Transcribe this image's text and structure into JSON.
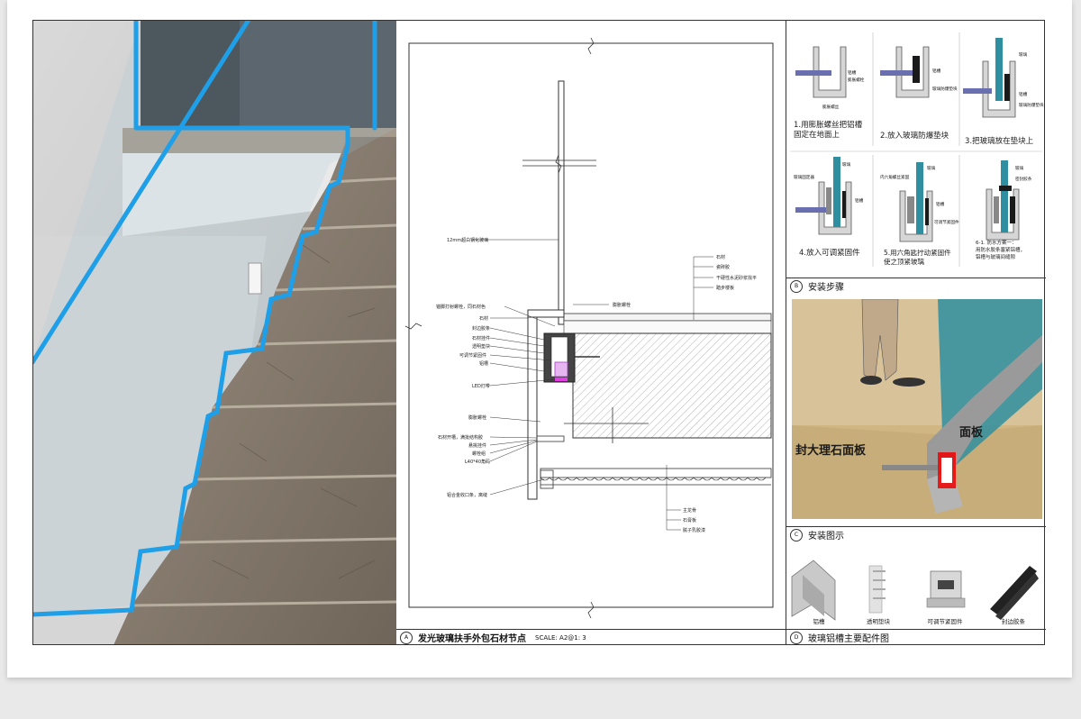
{
  "drawing": {
    "title": "发光玻璃扶手外包石材节点",
    "scale_label": "SCALE: A2@1: 3",
    "section_letter": "A",
    "labels_left": [
      "12mm超白钢化玻璃",
      "锚脚打射螺栓，同石材色",
      "石材",
      "封边胶条",
      "石材挂件",
      "透明垫块",
      "可调节紧固件",
      "铝槽",
      "LED灯带",
      "膨胀螺栓",
      "石材开槽，满批结构胶",
      "悬挑挂件",
      "螺栓组",
      "L40*40角码",
      "铝合金收口条，离缝"
    ],
    "labels_right_top": [
      "石材",
      "瓷砖胶",
      "干硬性水泥砂浆找平",
      "踏步楼板"
    ],
    "label_expansion": "膨胀螺栓",
    "labels_bottom": [
      "主龙骨",
      "石膏板",
      "腻子乳胶漆"
    ]
  },
  "steps": {
    "section_letter": "B",
    "title": "安装步骤",
    "items": [
      {
        "caption_line1": "1.用膨胀螺丝把铝槽",
        "caption_line2": "固定在地面上",
        "labels": [
          "铝槽",
          "膨胀螺栓",
          "膨胀螺丝"
        ]
      },
      {
        "caption_line1": "2.放入玻璃防爆垫块",
        "caption_line2": "",
        "labels": [
          "铝槽",
          "玻璃防爆垫块"
        ]
      },
      {
        "caption_line1": "3.把玻璃放在垫块上",
        "caption_line2": "",
        "labels": [
          "玻璃",
          "铝槽",
          "玻璃防爆垫块"
        ]
      },
      {
        "caption_line1": "4.放入可调紧固件",
        "caption_line2": "",
        "labels": [
          "玻璃固定器",
          "铝槽",
          "玻璃"
        ]
      },
      {
        "caption_line1": "5.用六角匙拧动紧固件",
        "caption_line2": "使之顶紧玻璃",
        "labels": [
          "内六角螺丝紧固",
          "铝槽",
          "玻璃",
          "可调节紧固件"
        ]
      },
      {
        "caption_line1": "6-1. 防水方案一：",
        "caption_line2": "用防水胶条塞紧铝槽，",
        "caption_line3": "铝槽与玻璃间缝隙",
        "labels": [
          "玻璃",
          "密封胶条"
        ]
      }
    ]
  },
  "figure": {
    "section_letter": "C",
    "title": "安装图示",
    "overlay_text_1": "封大理石面板",
    "overlay_text_2": "面板"
  },
  "accessories": {
    "section_letter": "D",
    "title": "玻璃铝槽主要配件图",
    "items": [
      "铝槽",
      "透明垫块",
      "可调节紧固件",
      "封边胶条"
    ]
  },
  "colors": {
    "led_blue": "#1e9fe8",
    "glass_teal": "#2f8fa0",
    "marble": "#8a7f72"
  }
}
